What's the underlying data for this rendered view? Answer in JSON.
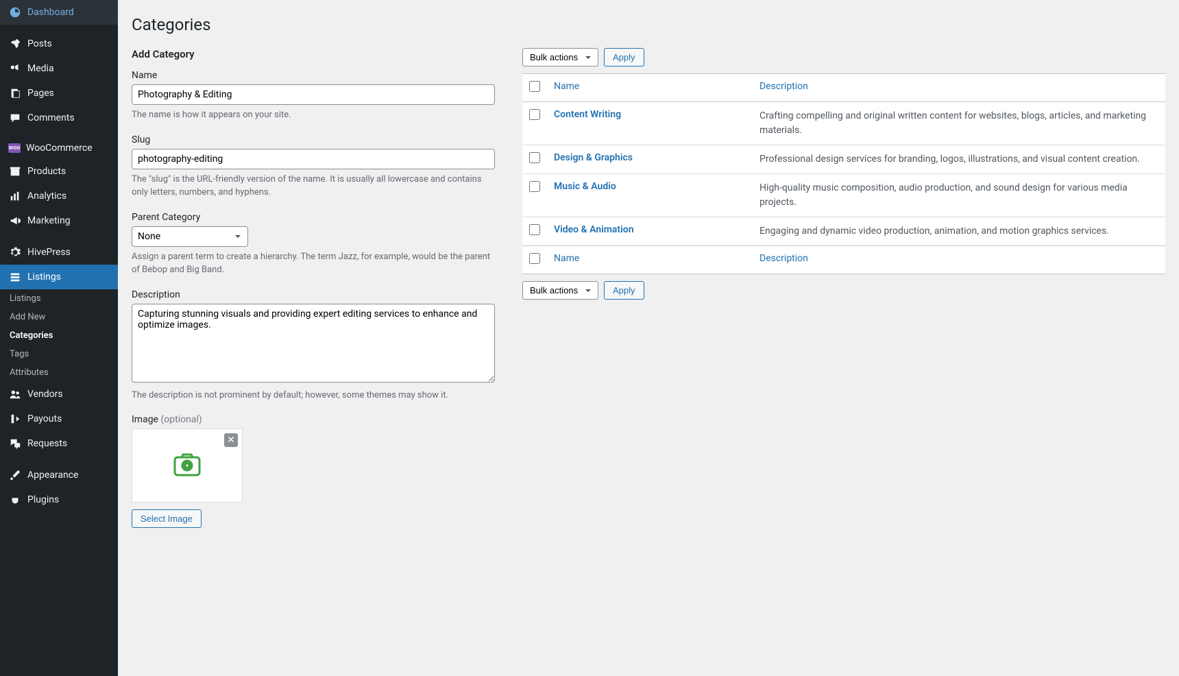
{
  "sidebar": {
    "items": [
      {
        "key": "dashboard",
        "label": "Dashboard",
        "icon": "dashboard"
      },
      {
        "key": "posts",
        "label": "Posts",
        "icon": "pin"
      },
      {
        "key": "media",
        "label": "Media",
        "icon": "media"
      },
      {
        "key": "pages",
        "label": "Pages",
        "icon": "pages"
      },
      {
        "key": "comments",
        "label": "Comments",
        "icon": "comment"
      },
      {
        "key": "woocommerce",
        "label": "WooCommerce",
        "icon": "woo"
      },
      {
        "key": "products",
        "label": "Products",
        "icon": "archive"
      },
      {
        "key": "analytics",
        "label": "Analytics",
        "icon": "chart"
      },
      {
        "key": "marketing",
        "label": "Marketing",
        "icon": "megaphone"
      },
      {
        "key": "hivepress",
        "label": "HivePress",
        "icon": "gear"
      },
      {
        "key": "listings",
        "label": "Listings",
        "icon": "listings",
        "active": true
      },
      {
        "key": "vendors",
        "label": "Vendors",
        "icon": "users"
      },
      {
        "key": "payouts",
        "label": "Payouts",
        "icon": "logout"
      },
      {
        "key": "requests",
        "label": "Requests",
        "icon": "chat"
      },
      {
        "key": "appearance",
        "label": "Appearance",
        "icon": "brush"
      },
      {
        "key": "plugins",
        "label": "Plugins",
        "icon": "plug"
      }
    ],
    "submenu": [
      {
        "label": "Listings"
      },
      {
        "label": "Add New"
      },
      {
        "label": "Categories",
        "current": true
      },
      {
        "label": "Tags"
      },
      {
        "label": "Attributes"
      }
    ]
  },
  "page": {
    "title": "Categories"
  },
  "form": {
    "heading": "Add Category",
    "name_label": "Name",
    "name_value": "Photography & Editing",
    "name_help": "The name is how it appears on your site.",
    "slug_label": "Slug",
    "slug_value": "photography-editing",
    "slug_help": "The \"slug\" is the URL-friendly version of the name. It is usually all lowercase and contains only letters, numbers, and hyphens.",
    "parent_label": "Parent Category",
    "parent_value": "None",
    "parent_help": "Assign a parent term to create a hierarchy. The term Jazz, for example, would be the parent of Bebop and Big Band.",
    "desc_label": "Description",
    "desc_value": "Capturing stunning visuals and providing expert editing services to enhance and optimize images.",
    "desc_help": "The description is not prominent by default; however, some themes may show it.",
    "image_label": "Image",
    "image_optional": "(optional)",
    "select_image_btn": "Select Image"
  },
  "bulk": {
    "select_label": "Bulk actions",
    "apply_label": "Apply"
  },
  "table": {
    "col_name": "Name",
    "col_desc": "Description",
    "rows": [
      {
        "name": "Content Writing",
        "desc": "Crafting compelling and original written content for websites, blogs, articles, and marketing materials."
      },
      {
        "name": "Design & Graphics",
        "desc": "Professional design services for branding, logos, illustrations, and visual content creation."
      },
      {
        "name": "Music & Audio",
        "desc": "High-quality music composition, audio production, and sound design for various media projects."
      },
      {
        "name": "Video & Animation",
        "desc": "Engaging and dynamic video production, animation, and motion graphics services."
      }
    ]
  }
}
